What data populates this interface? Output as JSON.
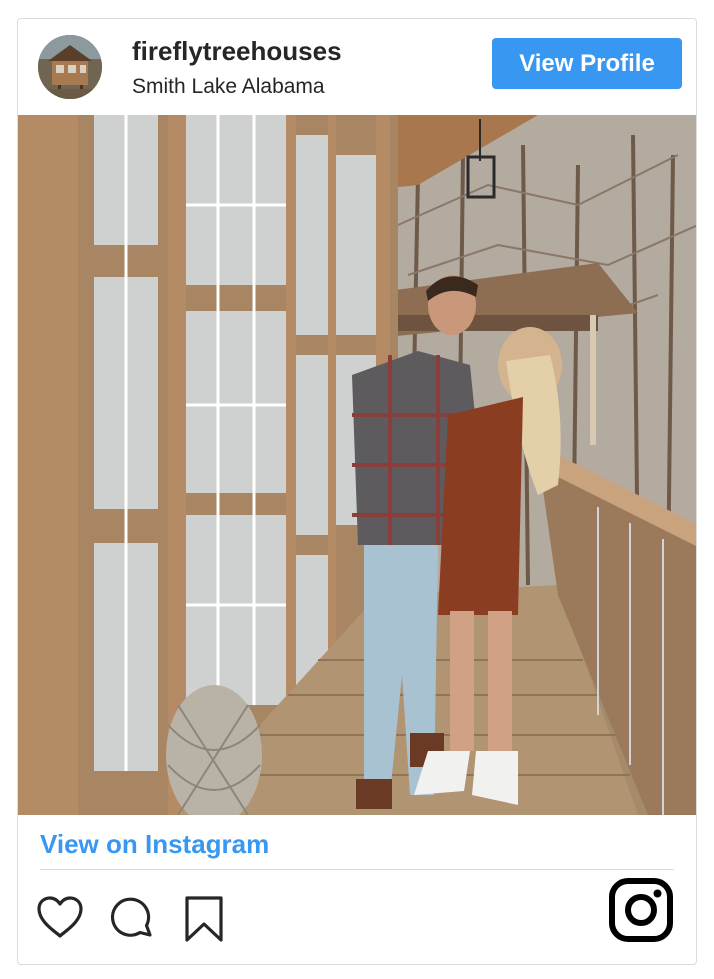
{
  "header": {
    "username": "fireflytreehouses",
    "location": "Smith Lake Alabama",
    "view_profile_label": "View Profile"
  },
  "footer": {
    "view_on_instagram_label": "View on Instagram"
  },
  "icons": {
    "like": "heart-icon",
    "comment": "comment-icon",
    "save": "bookmark-icon",
    "logo": "instagram-logo-icon"
  },
  "colors": {
    "accent": "#3897f0",
    "text": "#262626",
    "border": "#dbdbdb"
  }
}
